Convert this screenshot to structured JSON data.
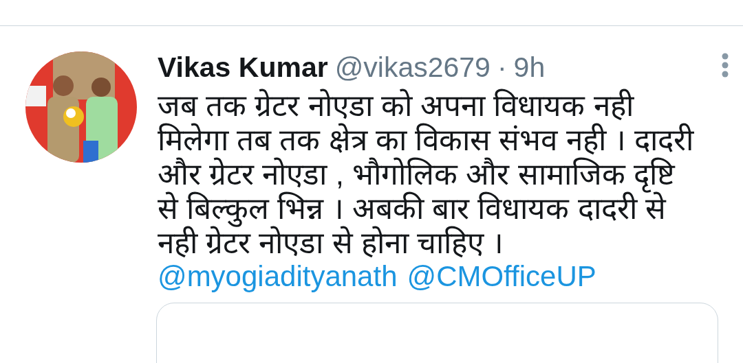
{
  "tweet": {
    "author": "Vikas Kumar",
    "handle": "@vikas2679",
    "separator": "·",
    "time": "9h",
    "text": "जब तक ग्रेटर नोएडा को अपना विधायक नही मिलेगा तब तक क्षेत्र का विकास संभव नही । दादरी और ग्रेटर नोएडा , भौगोलिक और सामाजिक दृष्टि से बिल्कुल भिन्न । अबकी बार विधायक दादरी से नही ग्रेटर नोएडा से होना चाहिए ।",
    "mentions": [
      "@myogiadityanath",
      "@CMOfficeUP"
    ],
    "quoted": {
      "kind": "card"
    }
  }
}
